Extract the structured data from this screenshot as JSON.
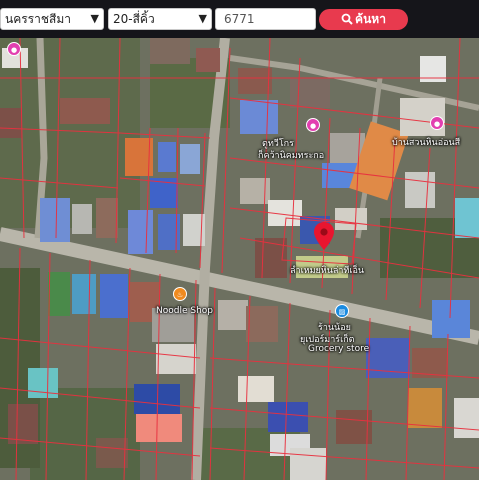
{
  "search": {
    "province": "นครราชสีมา",
    "size": "20-สี่คิ้ว",
    "parcel_value": "6771",
    "button_label": "ค้นหา"
  },
  "map": {
    "labels": {
      "top_right": "บ้านสวนหินอ่อนสี",
      "left_mid": "ตูทวีโกร",
      "left_mid2": "ก็คว้านิคมทระกอ",
      "center": "ลำเหมยหินล่าทีเอ็น",
      "noodle": "Noodle Shop",
      "grocery_th": "ร้านน้อย",
      "grocery_th2": "ยุเปอร์มาร์เก็ต",
      "grocery_en": "Grocery store"
    },
    "colors": {
      "pin": "#e8152f",
      "poi_pink": "#e23fb0",
      "poi_orange": "#f08a1f",
      "poi_blue": "#1a8be0",
      "parcel_line": "#e8313f"
    },
    "icons": [
      "map-pin-icon",
      "poi-pink-icon",
      "noodle-shop-icon",
      "grocery-store-icon"
    ]
  }
}
